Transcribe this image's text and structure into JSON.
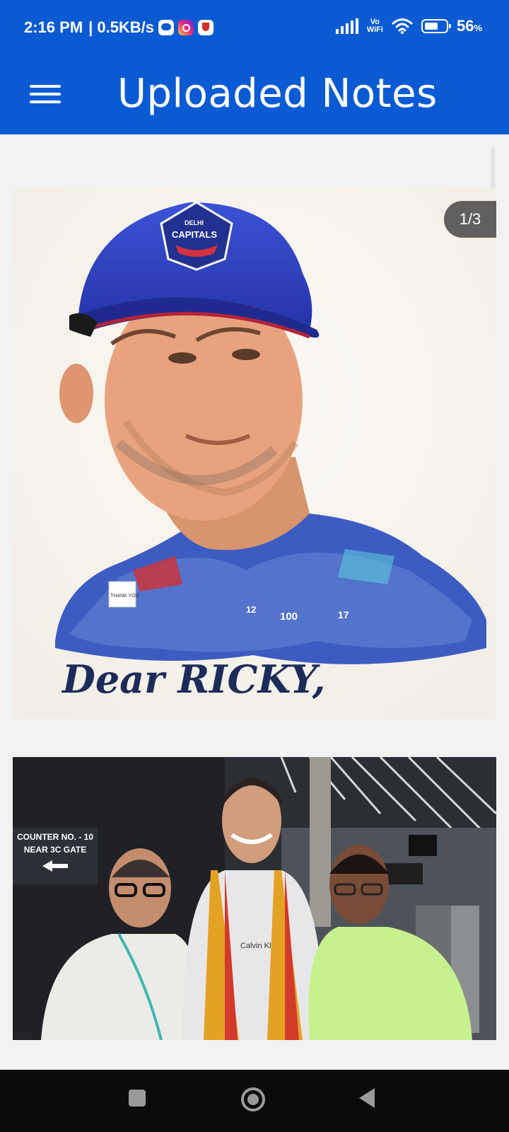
{
  "status_bar": {
    "time": "2:16 PM",
    "network_speed": "0.5KB/s",
    "separator": "|",
    "vowifi_top": "Vo",
    "vowifi_bottom": "WiFi",
    "battery_percent": "56",
    "battery_unit": "%",
    "notification_icons": [
      "message-icon",
      "instagram-icon",
      "trophy-icon"
    ]
  },
  "app_bar": {
    "title": "Uploaded Notes",
    "menu_icon": "hamburger-menu-icon"
  },
  "notes": [
    {
      "page_indicator": "1/3",
      "headline": "Dear RICKY,",
      "cap_badge_line1": "DELHI",
      "cap_badge_line2": "CAPITALS",
      "sign_text": "THANK YOU",
      "jersey_number_1": "12",
      "jersey_number_2": "100",
      "jersey_number_3": "17"
    },
    {
      "sign_line1": "COUNTER NO. - 10",
      "sign_line2": "NEAR 3C GATE",
      "shirt_text": "Calvin Kl"
    }
  ],
  "nav_bar": {
    "recent_icon": "square-icon",
    "home_icon": "circle-icon",
    "back_icon": "triangle-back-icon"
  },
  "colors": {
    "primary": "#0a5bd3",
    "headline": "#1d2b5a"
  }
}
